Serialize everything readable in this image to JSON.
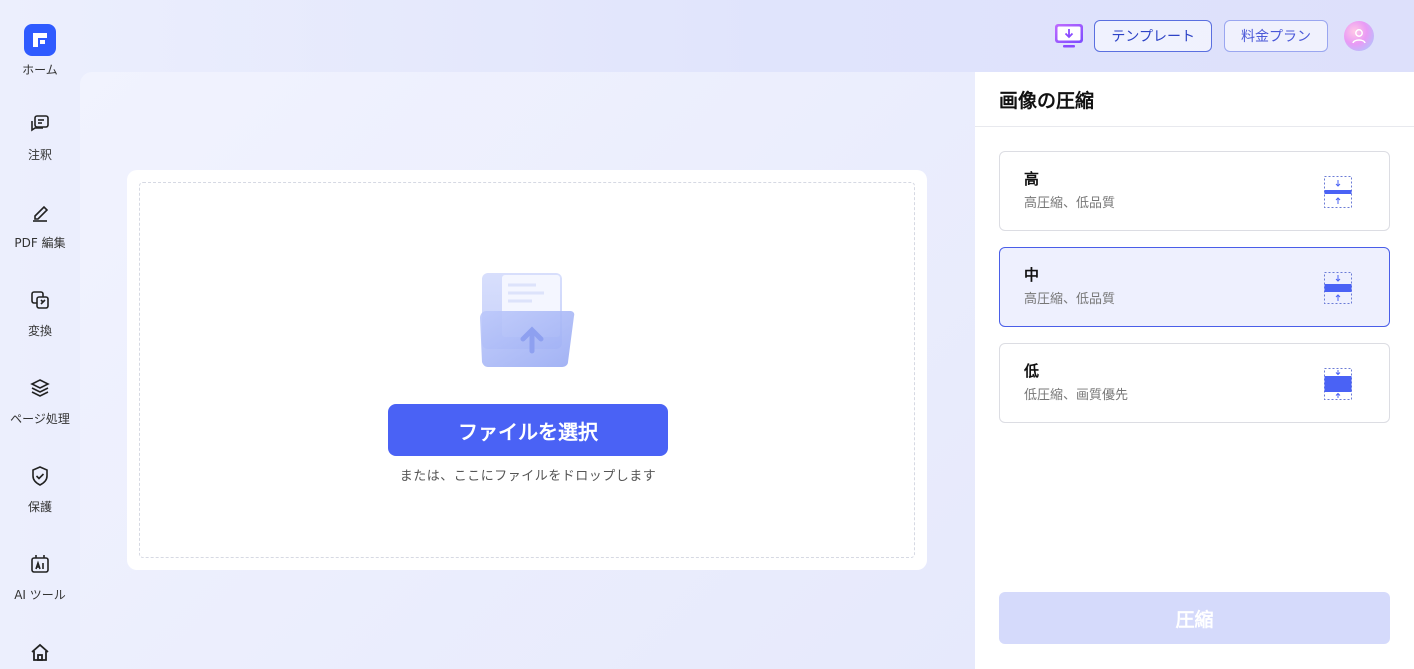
{
  "sidebar": {
    "items": [
      {
        "label": "ホーム",
        "icon": "home-logo-icon"
      },
      {
        "label": "注釈",
        "icon": "comment-icon"
      },
      {
        "label": "PDF 編集",
        "icon": "edit-pen-icon"
      },
      {
        "label": "変換",
        "icon": "convert-icon"
      },
      {
        "label": "ページ処理",
        "icon": "layers-icon"
      },
      {
        "label": "保護",
        "icon": "shield-icon"
      },
      {
        "label": "AI ツール",
        "icon": "ai-tool-icon"
      },
      {
        "label": "",
        "icon": "house-icon"
      }
    ]
  },
  "header": {
    "download_icon": "download-monitor-icon",
    "template_label": "テンプレート",
    "pricing_label": "料金プラン",
    "avatar_icon": "user-avatar-icon"
  },
  "upload": {
    "select_button": "ファイルを選択",
    "hint": "または、ここにファイルをドロップします",
    "folder_icon": "upload-folder-icon"
  },
  "panel": {
    "title": "画像の圧縮",
    "options": [
      {
        "title": "高",
        "desc": "高圧縮、低品質",
        "selected": false
      },
      {
        "title": "中",
        "desc": "高圧縮、低品質",
        "selected": true
      },
      {
        "title": "低",
        "desc": "低圧縮、画質優先",
        "selected": false
      }
    ],
    "compress_button": "圧縮"
  },
  "colors": {
    "accent": "#4a62f5",
    "selected_border": "#4a5ee8",
    "disabled_button": "#d5dafb"
  }
}
